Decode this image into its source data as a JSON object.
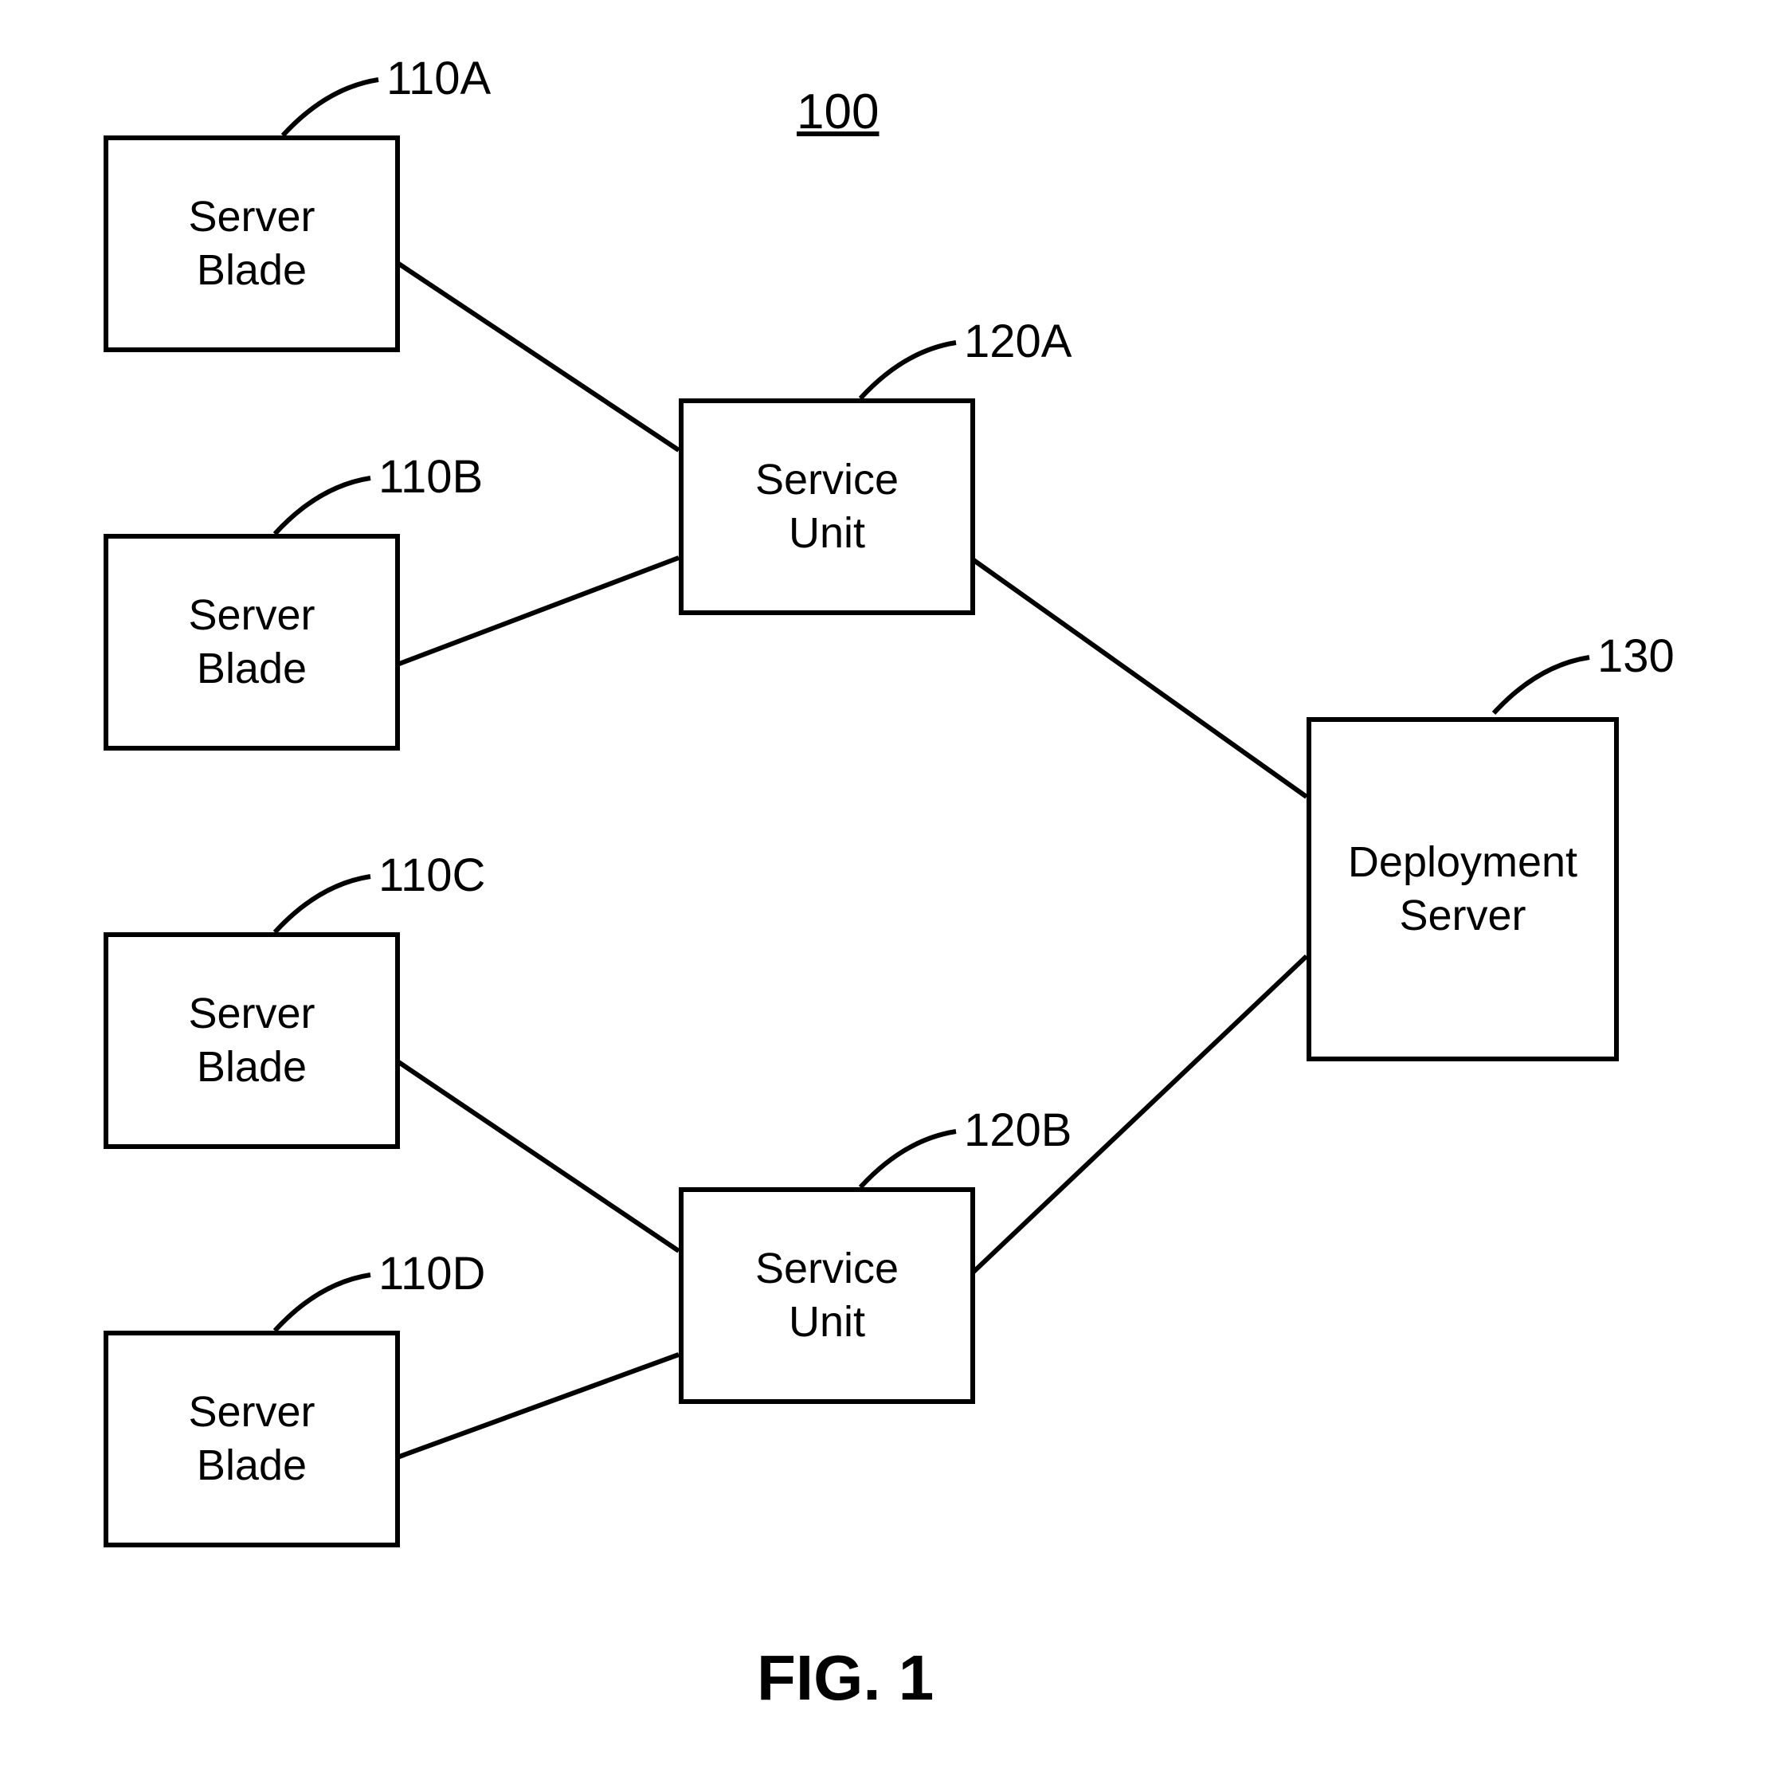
{
  "figure_id": "100",
  "figure_caption": "FIG. 1",
  "boxes": {
    "blade_a": {
      "label": "Server\nBlade",
      "callout": "110A"
    },
    "blade_b": {
      "label": "Server\nBlade",
      "callout": "110B"
    },
    "blade_c": {
      "label": "Server\nBlade",
      "callout": "110C"
    },
    "blade_d": {
      "label": "Server\nBlade",
      "callout": "110D"
    },
    "svc_a": {
      "label": "Service\nUnit",
      "callout": "120A"
    },
    "svc_b": {
      "label": "Service\nUnit",
      "callout": "120B"
    },
    "deploy": {
      "label": "Deployment\nServer",
      "callout": "130"
    }
  }
}
